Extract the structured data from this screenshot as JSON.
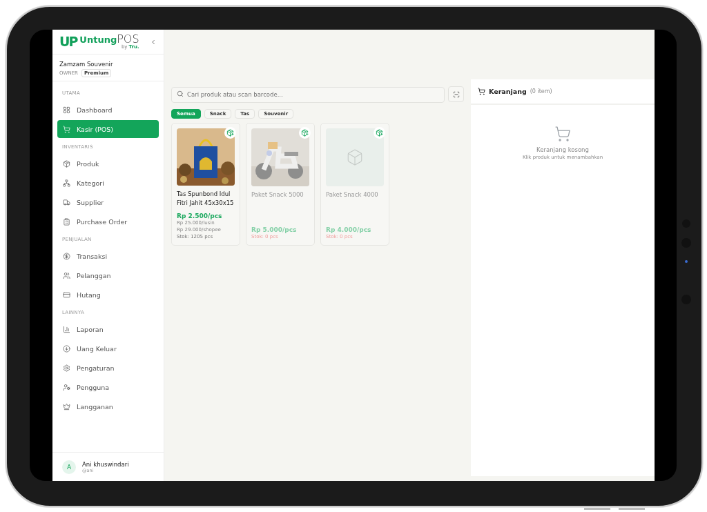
{
  "brand": {
    "mark": "UP",
    "name_bold": "Untung",
    "name_light": "POS",
    "by": "by",
    "maker": "Tru."
  },
  "store": {
    "name": "Zamzam Souvenir",
    "role": "OWNER",
    "plan": "Premium"
  },
  "nav": [
    {
      "heading": "UTAMA",
      "items": [
        {
          "label": "Dashboard",
          "selected": false
        },
        {
          "label": "Kasir (POS)",
          "selected": true
        }
      ]
    },
    {
      "heading": "INVENTARIS",
      "items": [
        {
          "label": "Produk",
          "selected": false
        },
        {
          "label": "Kategori",
          "selected": false
        },
        {
          "label": "Supplier",
          "selected": false
        },
        {
          "label": "Purchase Order",
          "selected": false
        }
      ]
    },
    {
      "heading": "PENJUALAN",
      "items": [
        {
          "label": "Transaksi",
          "selected": false
        },
        {
          "label": "Pelanggan",
          "selected": false
        },
        {
          "label": "Hutang",
          "selected": false
        }
      ]
    },
    {
      "heading": "LAINNYA",
      "items": [
        {
          "label": "Laporan",
          "selected": false
        },
        {
          "label": "Uang Keluar",
          "selected": false
        },
        {
          "label": "Pengaturan",
          "selected": false
        },
        {
          "label": "Pengguna",
          "selected": false
        },
        {
          "label": "Langganan",
          "selected": false
        }
      ]
    }
  ],
  "user": {
    "initial": "A",
    "name": "Ani khuswindari",
    "handle": "@ani"
  },
  "search": {
    "placeholder": "Cari produk atau scan barcode..."
  },
  "categories": [
    {
      "label": "Semua",
      "selected": true
    },
    {
      "label": "Snack",
      "selected": false
    },
    {
      "label": "Tas",
      "selected": false
    },
    {
      "label": "Souvenir",
      "selected": false
    }
  ],
  "products": [
    {
      "name": "Tas Spunbond Idul Fitri Jahit 45x30x15",
      "kind": "picture",
      "in_stock": true,
      "price": "Rp 2.500/pcs",
      "other_prices": [
        "Rp 25.000/lusin",
        "Rp 29.000/shopee"
      ],
      "stock": "Stok: 1205 pcs"
    },
    {
      "name": "Paket Snack 5000",
      "kind": "picture",
      "in_stock": false,
      "price": "Rp 5.000/pcs",
      "stock": "Stok: 0 pcs"
    },
    {
      "name": "Paket Snack 4000",
      "kind": "placeholder",
      "in_stock": false,
      "price": "Rp 4.000/pcs",
      "stock": "Stok: 0 pcs"
    }
  ],
  "cart": {
    "title": "Keranjang",
    "count": "(0 item)",
    "empty_title": "Keranjang kosong",
    "empty_hint": "Klik produk untuk menambahkan"
  }
}
